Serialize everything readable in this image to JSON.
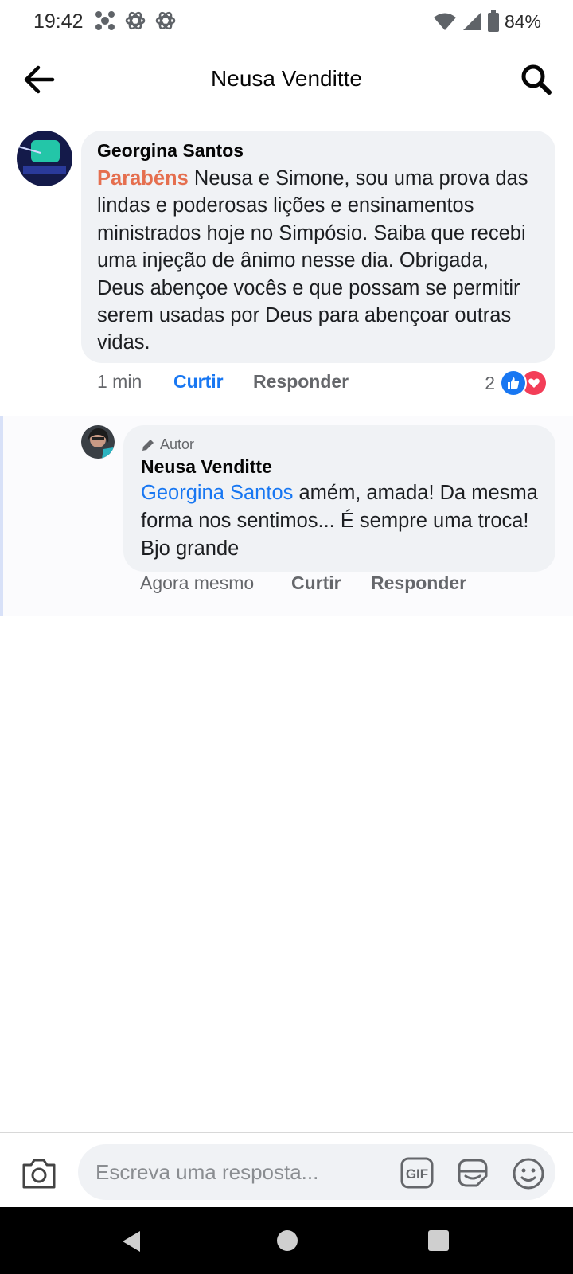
{
  "status_bar": {
    "time": "19:42",
    "battery": "84%",
    "notification_icons": [
      "app-notification-icon",
      "openai-icon",
      "openai-icon"
    ]
  },
  "header": {
    "title": "Neusa Venditte",
    "back_icon": "arrow-left-icon",
    "search_icon": "search-icon"
  },
  "comment": {
    "author": "Georgina Santos",
    "highlight": "Parabéns",
    "text": " Neusa e Simone, sou uma prova das lindas e poderosas lições e ensinamentos ministrados hoje no Simpósio. Saiba que recebi uma injeção de ânimo nesse dia. Obrigada, Deus abençoe vocês e que possam se permitir serem usadas por Deus para abençoar outras vidas.",
    "time": "1 min",
    "like_label": "Curtir",
    "reply_label": "Responder",
    "reaction_count": "2",
    "reactions": [
      "like-icon",
      "love-icon"
    ],
    "accent_color": "#e56f4f",
    "like_active_color": "#1877f2"
  },
  "reply": {
    "badge": "Autor",
    "author": "Neusa Venditte",
    "mention": "Georgina Santos",
    "text": " amém,  amada! Da mesma forma nos sentimos... É sempre uma troca! Bjo grande",
    "time": "Agora mesmo",
    "like_label": "Curtir",
    "reply_label": "Responder"
  },
  "composer": {
    "placeholder": "Escreva uma resposta...",
    "icons": [
      "camera-icon",
      "gif-icon",
      "sticker-icon",
      "emoji-icon"
    ]
  },
  "nav": {
    "icons": [
      "back-triangle-icon",
      "home-circle-icon",
      "recents-square-icon"
    ]
  }
}
